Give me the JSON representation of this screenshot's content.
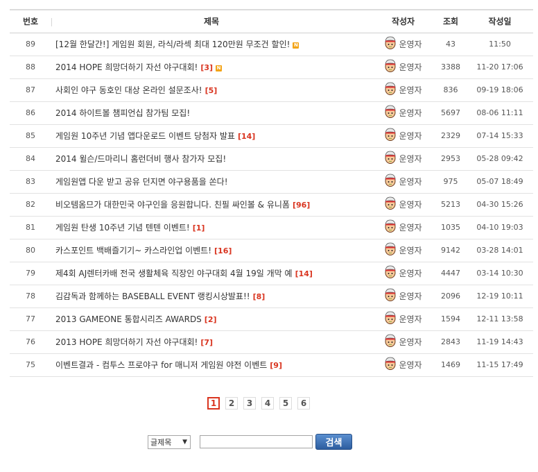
{
  "headers": {
    "num": "번호",
    "title": "제목",
    "author": "작성자",
    "views": "조회",
    "date": "작성일"
  },
  "rows": [
    {
      "num": "89",
      "title": "[12월 한달간!] 게임원 회원, 라식/라섹 최대 120만원 무조건 할인!",
      "comments": "",
      "new": true,
      "author": "운영자",
      "views": "43",
      "date": "11:50"
    },
    {
      "num": "88",
      "title": "2014 HOPE 희망더하기 자선 야구대회!",
      "comments": "[3]",
      "new": true,
      "author": "운영자",
      "views": "3388",
      "date": "11-20 17:06"
    },
    {
      "num": "87",
      "title": "사회인 야구 동호인 대상 온라인 설문조사!",
      "comments": "[5]",
      "new": false,
      "author": "운영자",
      "views": "836",
      "date": "09-19 18:06"
    },
    {
      "num": "86",
      "title": "2014 하이트볼 챔피언십 참가팀 모집!",
      "comments": "",
      "new": false,
      "author": "운영자",
      "views": "5697",
      "date": "08-06 11:11"
    },
    {
      "num": "85",
      "title": "게임원 10주년 기념 앱다운로드 이벤트 당첨자 발표",
      "comments": "[14]",
      "new": false,
      "author": "운영자",
      "views": "2329",
      "date": "07-14 15:33"
    },
    {
      "num": "84",
      "title": "2014 윌슨/드마리니 홈런더비 행사 참가자 모집!",
      "comments": "",
      "new": false,
      "author": "운영자",
      "views": "2953",
      "date": "05-28 09:42"
    },
    {
      "num": "83",
      "title": "게임원앱 다운 받고 공유 던지면 야구용품을 쏜다!",
      "comments": "",
      "new": false,
      "author": "운영자",
      "views": "975",
      "date": "05-07 18:49"
    },
    {
      "num": "82",
      "title": "비오템옴므가 대한민국 야구인을 응원합니다. 친필 싸인볼 & 유니폼",
      "comments": "[96]",
      "new": false,
      "author": "운영자",
      "views": "5213",
      "date": "04-30 15:26"
    },
    {
      "num": "81",
      "title": "게임원 탄생 10주년 기념 텐텐 이벤트!",
      "comments": "[1]",
      "new": false,
      "author": "운영자",
      "views": "1035",
      "date": "04-10 19:03"
    },
    {
      "num": "80",
      "title": "카스포인트 백배즐기기~ 카스라인업 이벤트!",
      "comments": "[16]",
      "new": false,
      "author": "운영자",
      "views": "9142",
      "date": "03-28 14:01"
    },
    {
      "num": "79",
      "title": "제4회 AJ렌터카배 전국 생활체육 직장인 야구대회 4월 19일 개막 예",
      "comments": "[14]",
      "new": false,
      "author": "운영자",
      "views": "4447",
      "date": "03-14 10:30"
    },
    {
      "num": "78",
      "title": "김감독과 함께하는 BASEBALL EVENT 랭킹시상발표!!",
      "comments": "[8]",
      "new": false,
      "author": "운영자",
      "views": "2096",
      "date": "12-19 10:11"
    },
    {
      "num": "77",
      "title": "2013 GAMEONE 통합시리즈 AWARDS",
      "comments": "[2]",
      "new": false,
      "author": "운영자",
      "views": "1594",
      "date": "12-11 13:58"
    },
    {
      "num": "76",
      "title": "2013 HOPE 희망더하기 자선 야구대회!",
      "comments": "[7]",
      "new": false,
      "author": "운영자",
      "views": "2843",
      "date": "11-19 14:43"
    },
    {
      "num": "75",
      "title": "이벤트결과 - 컴투스 프로야구 for 매니저 게임원 야전 이벤트",
      "comments": "[9]",
      "new": false,
      "author": "운영자",
      "views": "1469",
      "date": "11-15 17:49"
    }
  ],
  "pagination": {
    "pages": [
      "1",
      "2",
      "3",
      "4",
      "5",
      "6"
    ],
    "current": "1"
  },
  "search": {
    "select_value": "글제목",
    "input_value": "",
    "button_label": "검색"
  },
  "badge_text": "N",
  "colors": {
    "accent": "#d9341f",
    "button": "#2d5d9f",
    "new_badge": "#f3a417"
  }
}
